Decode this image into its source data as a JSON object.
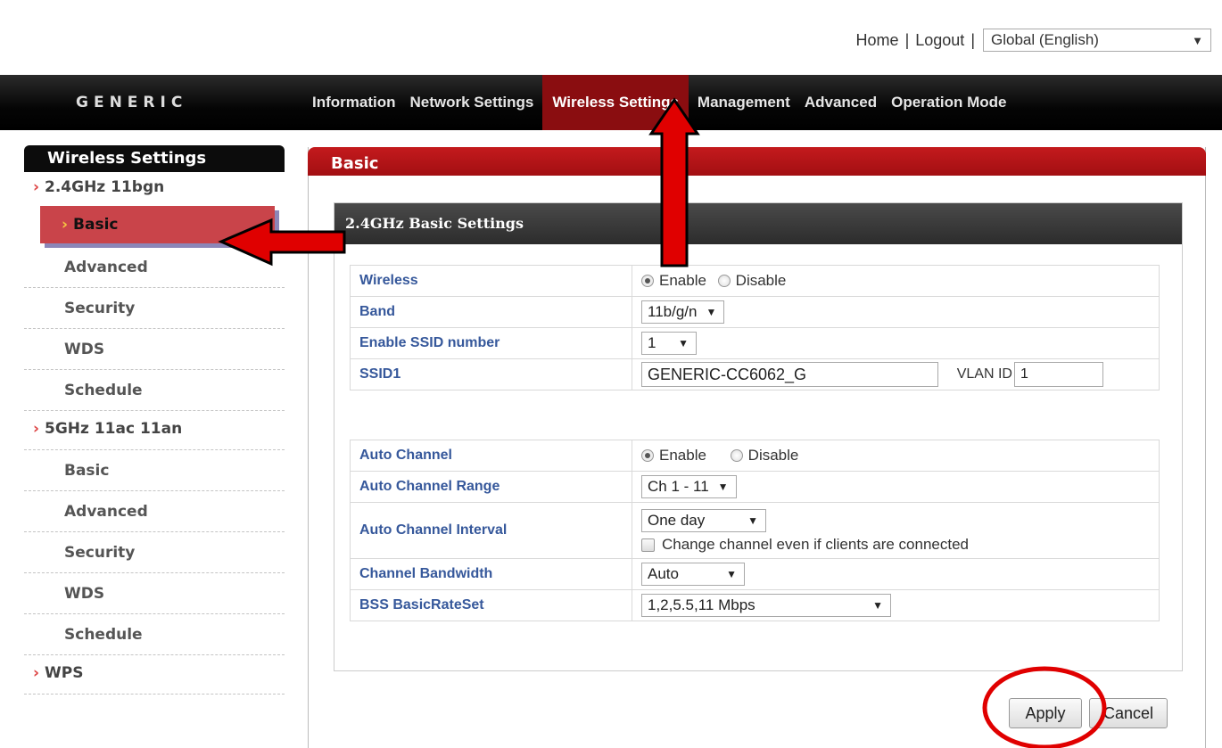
{
  "top": {
    "home": "Home",
    "logout": "Logout",
    "separator": "|",
    "language": "Global (English)"
  },
  "brand": "GENERIC",
  "nav": {
    "tabs": [
      "Information",
      "Network Settings",
      "Wireless Settings",
      "Management",
      "Advanced",
      "Operation Mode"
    ],
    "active": "Wireless Settings"
  },
  "sidebar": {
    "title": "Wireless Settings",
    "group1": "2.4GHz 11bgn",
    "group1_items": [
      "Basic",
      "Advanced",
      "Security",
      "WDS",
      "Schedule"
    ],
    "group2": "5GHz 11ac 11an",
    "group2_items": [
      "Basic",
      "Advanced",
      "Security",
      "WDS",
      "Schedule"
    ],
    "group3": "WPS"
  },
  "main": {
    "title": "Basic",
    "card_title": "2.4GHz Basic Settings"
  },
  "form": {
    "wireless_label": "Wireless",
    "enable": "Enable",
    "disable": "Disable",
    "wireless_value": "Enable",
    "band_label": "Band",
    "band_value": "11b/g/n",
    "ssid_num_label": "Enable SSID number",
    "ssid_num_value": "1",
    "ssid1_label": "SSID1",
    "ssid1_value": "GENERIC-CC6062_G",
    "vlan_label": "VLAN ID",
    "vlan_value": "1",
    "auto_channel_label": "Auto Channel",
    "auto_channel_value": "Enable",
    "range_label": "Auto Channel Range",
    "range_value": "Ch 1 - 11",
    "interval_label": "Auto Channel Interval",
    "interval_value": "One day",
    "change_channel_label": "Change channel even if clients are connected",
    "change_channel_checked": false,
    "bandwidth_label": "Channel Bandwidth",
    "bandwidth_value": "Auto",
    "bss_label": "BSS BasicRateSet",
    "bss_value": "1,2,5.5,11 Mbps"
  },
  "buttons": {
    "apply": "Apply",
    "cancel": "Cancel"
  },
  "colors": {
    "active_tab": "#8a0d10",
    "main_header": "#b31418",
    "annotation_red": "#e00000",
    "label_blue": "#36589b"
  }
}
